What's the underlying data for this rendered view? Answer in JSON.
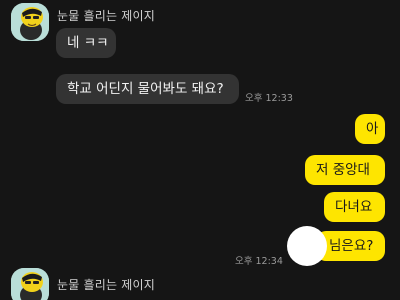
{
  "chat": {
    "sender_name": "눈물 흘리는 제이지",
    "messages_in": [
      {
        "text": "네 ㅋㅋ"
      },
      {
        "text": "학교 어딘지 물어봐도 돼요?",
        "time": "오후 12:33"
      }
    ],
    "messages_out": [
      {
        "text": "아"
      },
      {
        "text": "저 중앙대"
      },
      {
        "text": "다녀요"
      },
      {
        "text": "님은요?",
        "time": "오후 12:34"
      }
    ],
    "next_sender_name": "눈물 흘리는 제이지"
  },
  "colors": {
    "background": "#151515",
    "incoming_bubble": "#333333",
    "outgoing_bubble": "#fee500",
    "avatar_bg": "#b9ded8"
  }
}
